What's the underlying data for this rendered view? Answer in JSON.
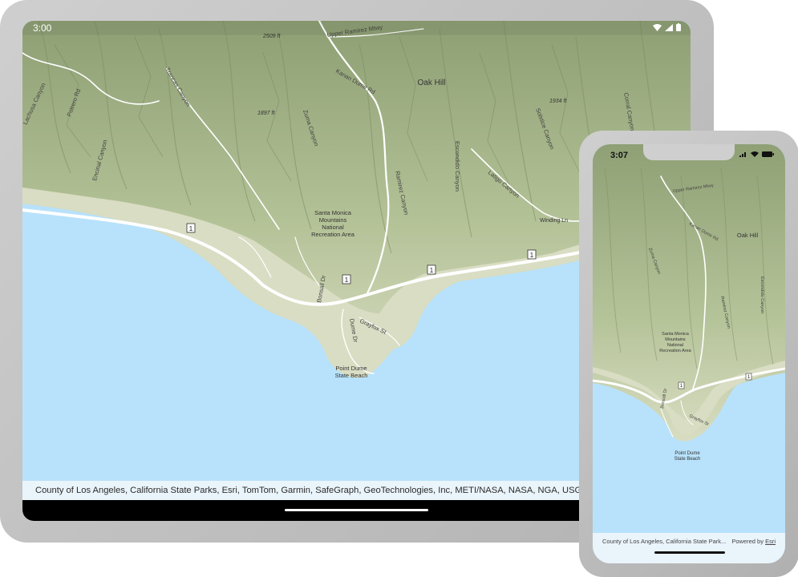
{
  "tablet": {
    "status_time": "3:00",
    "attribution": "County of Los Angeles, California State Parks, Esri, TomTom, Garmin, SafeGraph, GeoTechnologies, Inc, METI/NASA, NASA, NGA, USGS, Bureau of Land Mana"
  },
  "phone": {
    "status_time": "3:07",
    "attribution": "County of Los Angeles, California State Park...",
    "powered_by": "Powered by",
    "powered_brand": "Esri"
  },
  "map_labels": {
    "oak_hill": "Oak Hill",
    "park_line1": "Santa Monica",
    "park_line2": "Mountains",
    "park_line3": "National",
    "park_line4": "Recreation Area",
    "point_dume_1": "Point Dume",
    "point_dume_2": "State Beach",
    "zuma_canyon": "Zuma Canyon",
    "ramirez_canyon": "Ramirez Canyon",
    "escondido_canyon": "Escondido Canyon",
    "latigo_canyon": "Latigo Canyon",
    "solstice_canyon": "Solstice Canyon",
    "corral_canyon": "Corral Canyon",
    "trancas_canyon": "Trancas Canyon",
    "encinal_canyon": "Encinal Canyon",
    "lachusa_canyon": "Lachusa Canyon",
    "potrero_rd": "Potrero Rd",
    "kanan_dume_rd": "Kanan Dume Rd",
    "upper_ramirez": "Upper Ramirez Mtwy",
    "bonsall_dr": "Bonsall Dr",
    "dume_dr": "Dume Dr",
    "grayfox_st": "Grayfox St",
    "winding_ln": "Winding Ln",
    "elev_2509": "2509 ft",
    "elev_1897": "1897 ft",
    "elev_1934": "1934 ft",
    "route_1": "1"
  },
  "colors": {
    "ocean": "#b8e2fb",
    "terrain": "#c8d2b0",
    "terrain_dark": "#9aab7c",
    "road": "#ffffff",
    "device_frame": "#c0c0c0"
  }
}
